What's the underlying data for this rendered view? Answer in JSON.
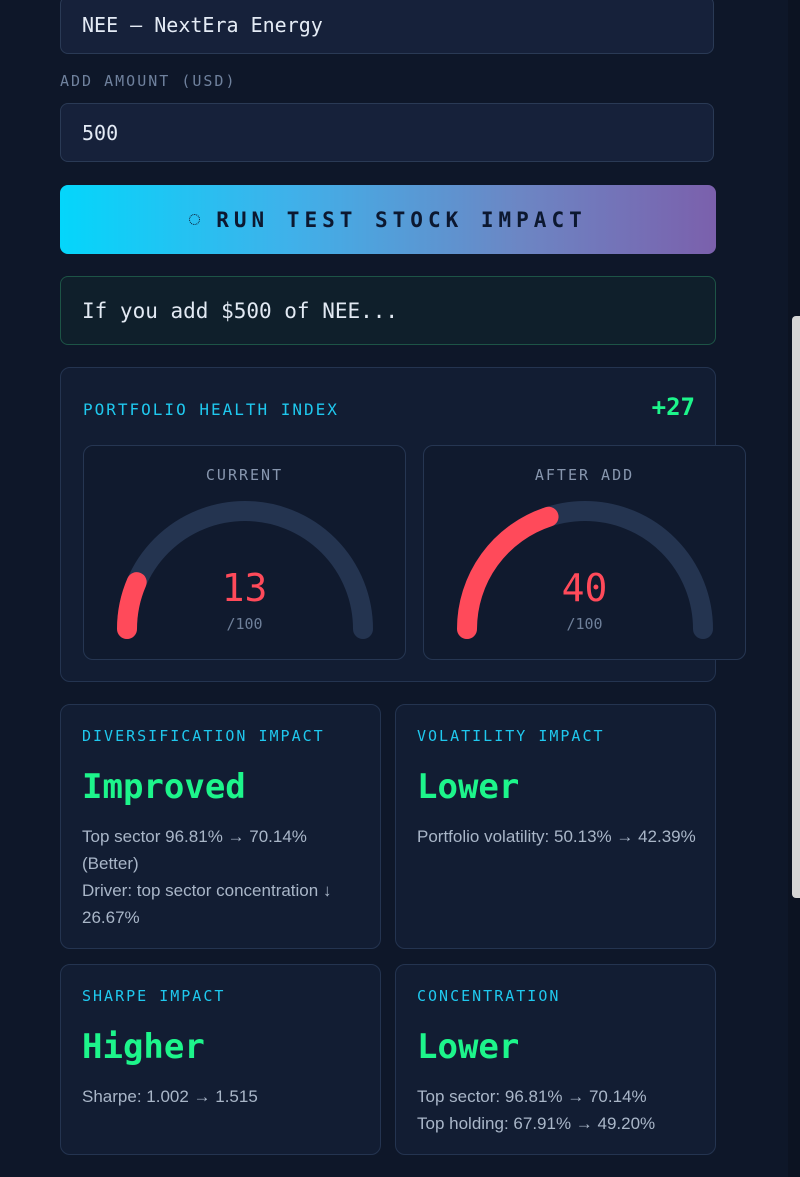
{
  "form": {
    "stock_value": "NEE — NextEra Energy",
    "amount_label": "ADD AMOUNT (USD)",
    "amount_value": "500",
    "run_button_label": "RUN TEST STOCK IMPACT"
  },
  "hint": {
    "text": "If you add $500 of NEE..."
  },
  "health": {
    "title": "PORTFOLIO HEALTH INDEX",
    "delta": "+27",
    "current": {
      "label": "CURRENT",
      "value": 13,
      "max_label": "/100"
    },
    "after": {
      "label": "AFTER ADD",
      "value": 40,
      "max_label": "/100"
    },
    "gauge_color": "#ff4a5a",
    "track_color": "#243450"
  },
  "impacts": [
    {
      "title": "DIVERSIFICATION IMPACT",
      "value": "Improved",
      "details": [
        "Top sector 96.81% → 70.14% (Better)",
        "Driver: top sector concentration ↓ 26.67%"
      ]
    },
    {
      "title": "VOLATILITY IMPACT",
      "value": "Lower",
      "details": [
        "Portfolio volatility: 50.13% → 42.39%"
      ]
    },
    {
      "title": "SHARPE IMPACT",
      "value": "Higher",
      "details": [
        "Sharpe: 1.002 → 1.515"
      ]
    },
    {
      "title": "CONCENTRATION",
      "value": "Lower",
      "details": [
        "Top sector: 96.81% → 70.14%",
        "Top holding: 67.91% → 49.20%"
      ]
    }
  ],
  "colors": {
    "accent_cyan": "#1fc8ee",
    "positive_green": "#1df58b",
    "negative_red": "#ff4a5a"
  }
}
